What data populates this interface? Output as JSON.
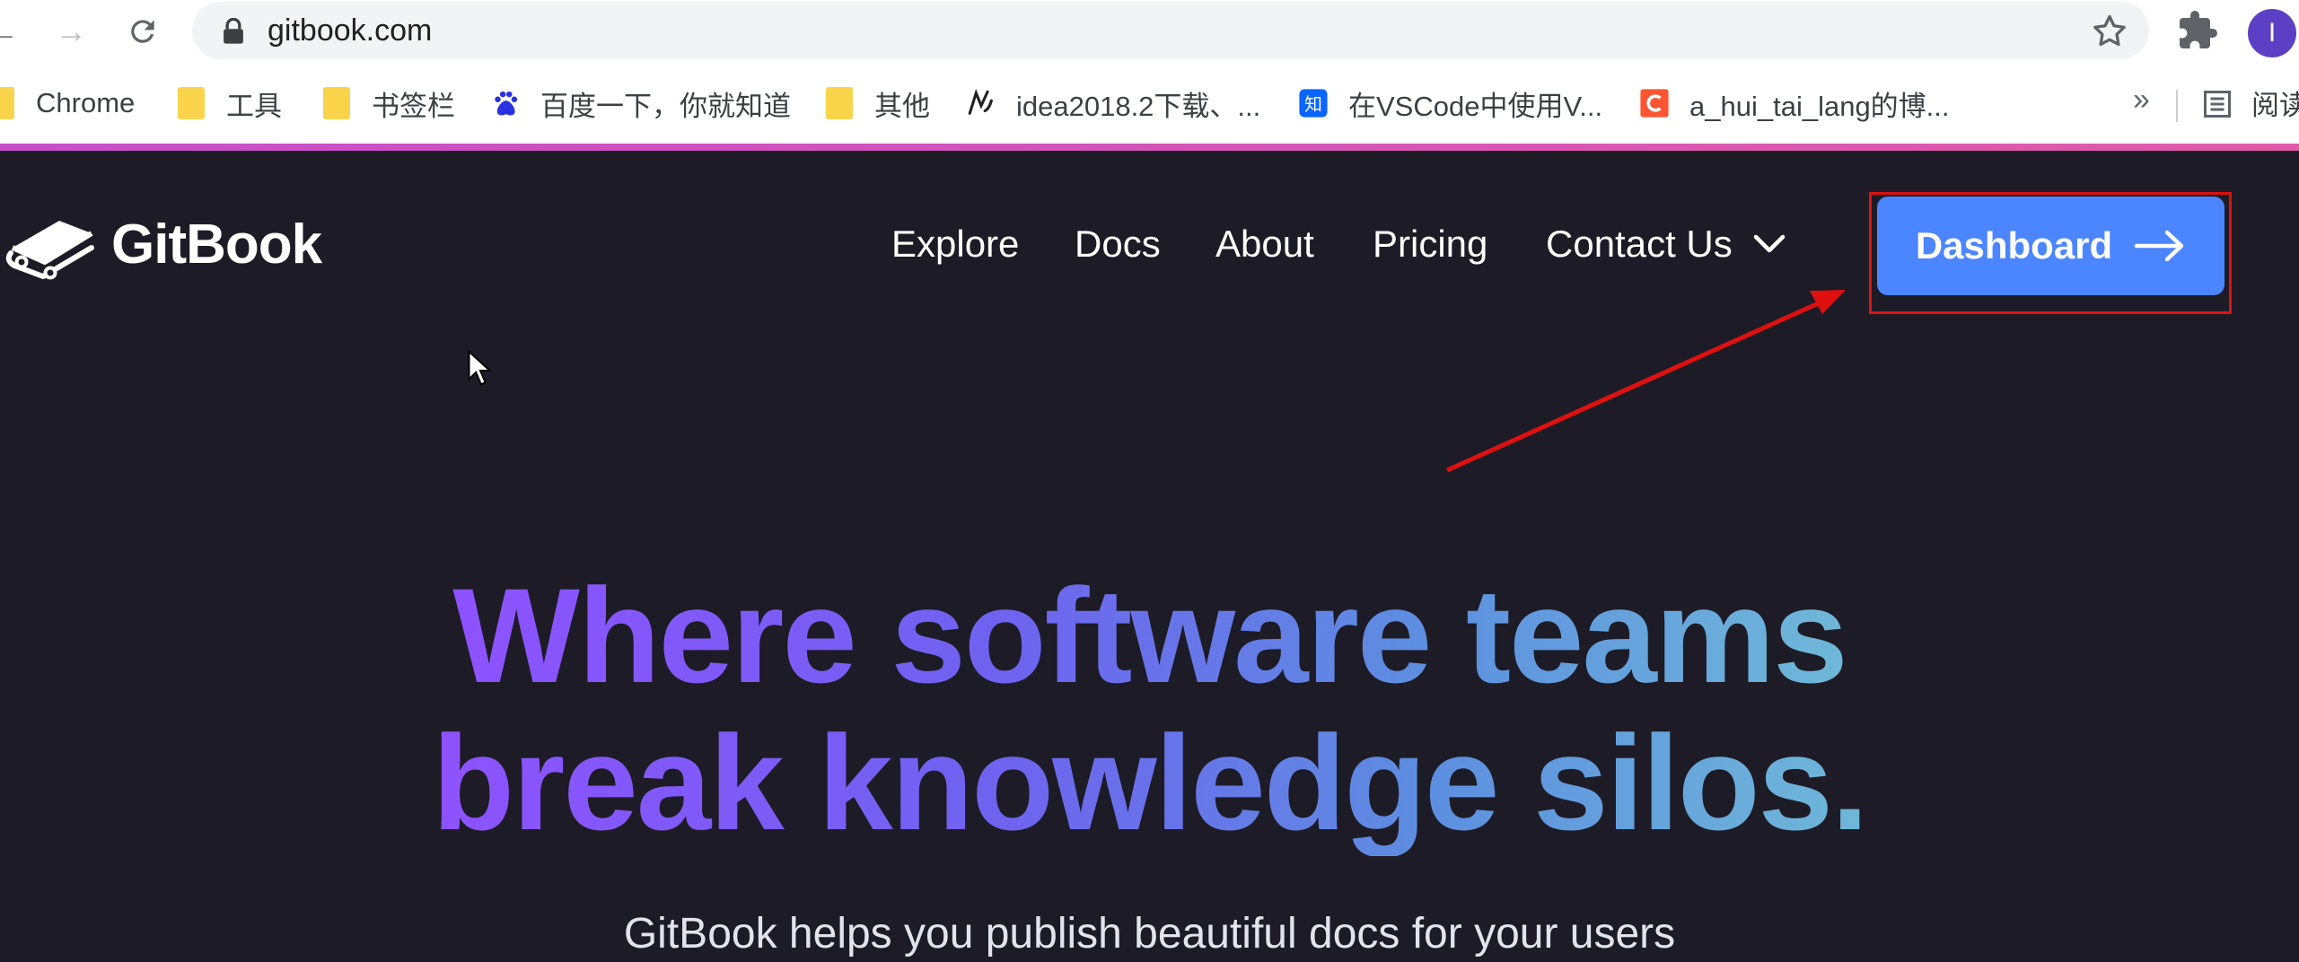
{
  "browser": {
    "url": "gitbook.com",
    "avatar_initial": "I",
    "bookmarks": [
      {
        "label": "Chrome",
        "icon": "folder-icon"
      },
      {
        "label": "工具",
        "icon": "folder-icon"
      },
      {
        "label": "书签栏",
        "icon": "folder-icon"
      },
      {
        "label": "百度一下，你就知道",
        "icon": "baidu-icon"
      },
      {
        "label": "其他",
        "icon": "folder-icon"
      },
      {
        "label": "idea2018.2下载、...",
        "icon": "idea-icon"
      },
      {
        "label": "在VSCode中使用V...",
        "icon": "zhihu-icon"
      },
      {
        "label": "a_hui_tai_lang的博...",
        "icon": "csdn-icon"
      }
    ],
    "overflow_label": "»",
    "reading_list_label": "阅读"
  },
  "site": {
    "brand": "GitBook",
    "nav": {
      "explore": "Explore",
      "docs": "Docs",
      "about": "About",
      "pricing": "Pricing",
      "contact": "Contact Us"
    },
    "dashboard_label": "Dashboard",
    "hero": {
      "line1": "Where software teams",
      "line2": "break knowledge silos.",
      "subtitle": "GitBook helps you publish beautiful docs for your users"
    }
  },
  "colors": {
    "page_bg": "#1d1c26",
    "button_accent": "#4b85ff",
    "annotation_red": "#e01010",
    "gradient_start": "#8d52ff",
    "gradient_end": "#6fb8d8"
  }
}
